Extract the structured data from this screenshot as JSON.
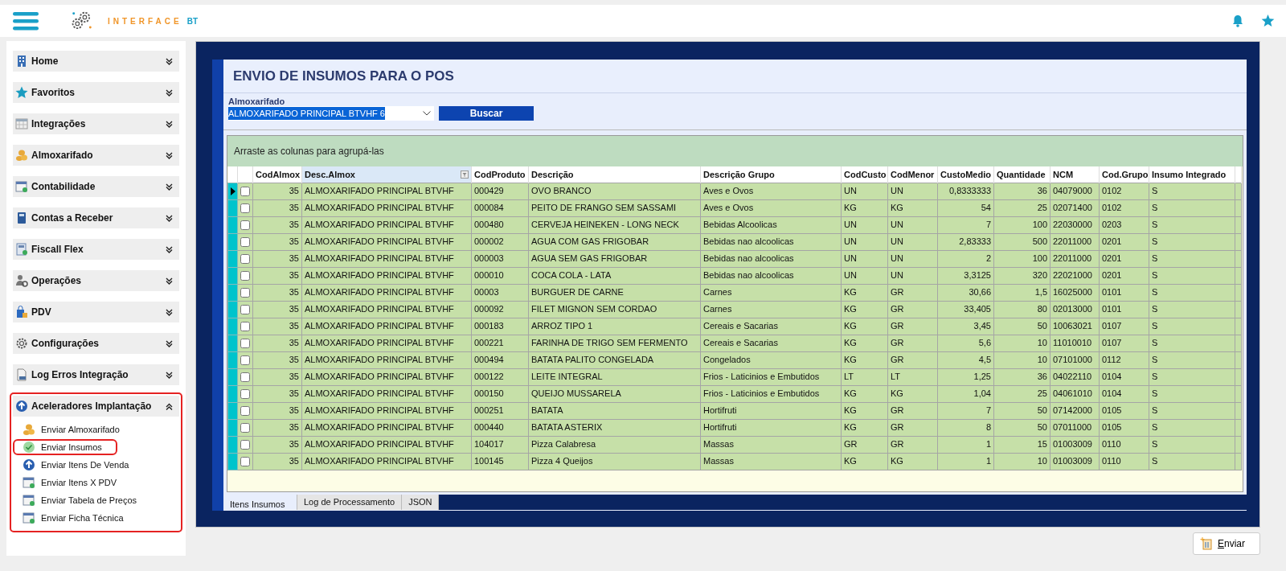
{
  "header": {
    "logo_word": "INTERFACE",
    "logo_suffix": "BT"
  },
  "sidebar": {
    "items": [
      {
        "label": "Home",
        "expanded": false
      },
      {
        "label": "Favoritos",
        "expanded": false
      },
      {
        "label": "Integrações",
        "expanded": false
      },
      {
        "label": "Almoxarifado",
        "expanded": false
      },
      {
        "label": "Contabilidade",
        "expanded": false
      },
      {
        "label": "Contas a Receber",
        "expanded": false
      },
      {
        "label": "Fiscall Flex",
        "expanded": false
      },
      {
        "label": "Operações",
        "expanded": false
      },
      {
        "label": "PDV",
        "expanded": false
      },
      {
        "label": "Configurações",
        "expanded": false
      },
      {
        "label": "Log Erros Integração",
        "expanded": false
      },
      {
        "label": "Aceleradores Implantação",
        "expanded": true,
        "children": [
          {
            "label": "Enviar Almoxarifado",
            "selected": false
          },
          {
            "label": "Enviar Insumos",
            "selected": true
          },
          {
            "label": "Enviar Itens De Venda",
            "selected": false
          },
          {
            "label": "Enviar Itens X PDV",
            "selected": false
          },
          {
            "label": "Enviar Tabela de Preços",
            "selected": false
          },
          {
            "label": "Enviar Ficha Técnica",
            "selected": false
          }
        ]
      }
    ]
  },
  "form": {
    "title": "ENVIO DE INSUMOS PARA O POS",
    "field_label": "Almoxarifado",
    "field_value": "ALMOXARIFADO PRINCIPAL BTVHF 6",
    "text_selected": true,
    "search_button": "Buscar"
  },
  "grid": {
    "group_hint": "Arraste as colunas para agrupá-las",
    "columns": [
      {
        "label": "CodAlmox",
        "numeric": true,
        "selected": false
      },
      {
        "label": "Desc.Almox",
        "numeric": false,
        "selected": true
      },
      {
        "label": "CodProduto",
        "numeric": false,
        "selected": false
      },
      {
        "label": "Descrição",
        "numeric": false,
        "selected": false
      },
      {
        "label": "Descrição Grupo",
        "numeric": false,
        "selected": false
      },
      {
        "label": "CodCusto",
        "numeric": false,
        "selected": false
      },
      {
        "label": "CodMenor",
        "numeric": false,
        "selected": false
      },
      {
        "label": "CustoMedio",
        "numeric": true,
        "selected": false
      },
      {
        "label": "Quantidade",
        "numeric": true,
        "selected": false
      },
      {
        "label": "NCM",
        "numeric": false,
        "selected": false
      },
      {
        "label": "Cod.Grupo",
        "numeric": false,
        "selected": false
      },
      {
        "label": "Insumo Integrado",
        "numeric": false,
        "selected": false
      }
    ],
    "rows": [
      {
        "current": true,
        "checked": false,
        "cells": [
          "35",
          "ALMOXARIFADO PRINCIPAL BTVHF",
          "000429",
          "OVO BRANCO",
          "Aves e Ovos",
          "UN",
          "UN",
          "0,8333333",
          "36",
          "04079000",
          "0102",
          "S"
        ]
      },
      {
        "current": false,
        "checked": false,
        "cells": [
          "35",
          "ALMOXARIFADO PRINCIPAL BTVHF",
          "000084",
          "PEITO DE FRANGO SEM SASSAMI",
          "Aves e Ovos",
          "KG",
          "KG",
          "54",
          "25",
          "02071400",
          "0102",
          "S"
        ]
      },
      {
        "current": false,
        "checked": false,
        "cells": [
          "35",
          "ALMOXARIFADO PRINCIPAL BTVHF",
          "000480",
          "CERVEJA HEINEKEN - LONG NECK",
          "Bebidas Alcoolicas",
          "UN",
          "UN",
          "7",
          "100",
          "22030000",
          "0203",
          "S"
        ]
      },
      {
        "current": false,
        "checked": false,
        "cells": [
          "35",
          "ALMOXARIFADO PRINCIPAL BTVHF",
          "000002",
          "AGUA COM GAS FRIGOBAR",
          "Bebidas nao alcoolicas",
          "UN",
          "UN",
          "2,83333",
          "500",
          "22011000",
          "0201",
          "S"
        ]
      },
      {
        "current": false,
        "checked": false,
        "cells": [
          "35",
          "ALMOXARIFADO PRINCIPAL BTVHF",
          "000003",
          "AGUA SEM GAS FRIGOBAR",
          "Bebidas nao alcoolicas",
          "UN",
          "UN",
          "2",
          "100",
          "22011000",
          "0201",
          "S"
        ]
      },
      {
        "current": false,
        "checked": false,
        "cells": [
          "35",
          "ALMOXARIFADO PRINCIPAL BTVHF",
          "000010",
          "COCA COLA - LATA",
          "Bebidas nao alcoolicas",
          "UN",
          "UN",
          "3,3125",
          "320",
          "22021000",
          "0201",
          "S"
        ]
      },
      {
        "current": false,
        "checked": false,
        "cells": [
          "35",
          "ALMOXARIFADO PRINCIPAL BTVHF",
          "00003",
          "BURGUER DE CARNE",
          "Carnes",
          "KG",
          "GR",
          "30,66",
          "1,5",
          "16025000",
          "0101",
          "S"
        ]
      },
      {
        "current": false,
        "checked": false,
        "cells": [
          "35",
          "ALMOXARIFADO PRINCIPAL BTVHF",
          "000092",
          "FILET MIGNON SEM CORDAO",
          "Carnes",
          "KG",
          "GR",
          "33,405",
          "80",
          "02013000",
          "0101",
          "S"
        ]
      },
      {
        "current": false,
        "checked": false,
        "cells": [
          "35",
          "ALMOXARIFADO PRINCIPAL BTVHF",
          "000183",
          "ARROZ TIPO 1",
          "Cereais e Sacarias",
          "KG",
          "GR",
          "3,45",
          "50",
          "10063021",
          "0107",
          "S"
        ]
      },
      {
        "current": false,
        "checked": false,
        "cells": [
          "35",
          "ALMOXARIFADO PRINCIPAL BTVHF",
          "000221",
          "FARINHA DE TRIGO SEM FERMENTO",
          "Cereais e Sacarias",
          "KG",
          "GR",
          "5,6",
          "10",
          "11010010",
          "0107",
          "S"
        ]
      },
      {
        "current": false,
        "checked": false,
        "cells": [
          "35",
          "ALMOXARIFADO PRINCIPAL BTVHF",
          "000494",
          "BATATA PALITO CONGELADA",
          "Congelados",
          "KG",
          "GR",
          "4,5",
          "10",
          "07101000",
          "0112",
          "S"
        ]
      },
      {
        "current": false,
        "checked": false,
        "cells": [
          "35",
          "ALMOXARIFADO PRINCIPAL BTVHF",
          "000122",
          "LEITE INTEGRAL",
          "Frios - Laticinios e Embutidos",
          "LT",
          "LT",
          "1,25",
          "36",
          "04022110",
          "0104",
          "S"
        ]
      },
      {
        "current": false,
        "checked": false,
        "cells": [
          "35",
          "ALMOXARIFADO PRINCIPAL BTVHF",
          "000150",
          "QUEIJO MUSSARELA",
          "Frios - Laticinios e Embutidos",
          "KG",
          "KG",
          "1,04",
          "25",
          "04061010",
          "0104",
          "S"
        ]
      },
      {
        "current": false,
        "checked": false,
        "cells": [
          "35",
          "ALMOXARIFADO PRINCIPAL BTVHF",
          "000251",
          "BATATA",
          "Hortifruti",
          "KG",
          "GR",
          "7",
          "50",
          "07142000",
          "0105",
          "S"
        ]
      },
      {
        "current": false,
        "checked": false,
        "cells": [
          "35",
          "ALMOXARIFADO PRINCIPAL BTVHF",
          "000440",
          "BATATA ASTERIX",
          "Hortifruti",
          "KG",
          "GR",
          "8",
          "50",
          "07011000",
          "0105",
          "S"
        ]
      },
      {
        "current": false,
        "checked": false,
        "cells": [
          "35",
          "ALMOXARIFADO PRINCIPAL BTVHF",
          "104017",
          "Pizza Calabresa",
          "Massas",
          "GR",
          "GR",
          "1",
          "15",
          "01003009",
          "0110",
          "S"
        ]
      },
      {
        "current": false,
        "checked": false,
        "cells": [
          "35",
          "ALMOXARIFADO PRINCIPAL BTVHF",
          "100145",
          "Pizza 4 Queijos",
          "Massas",
          "KG",
          "KG",
          "1",
          "10",
          "01003009",
          "0110",
          "S"
        ]
      }
    ]
  },
  "tabs": [
    {
      "label": "Itens Insumos",
      "selected": true
    },
    {
      "label": "Log de Processamento",
      "selected": false
    },
    {
      "label": "JSON",
      "selected": false
    }
  ],
  "footer": {
    "send_button": "Enviar"
  }
}
